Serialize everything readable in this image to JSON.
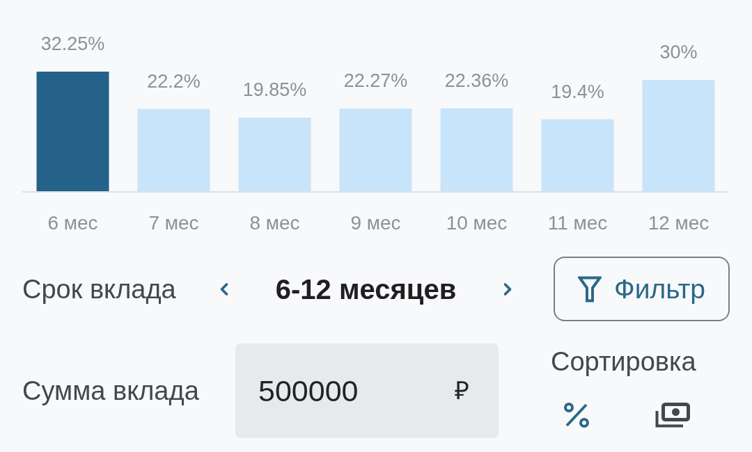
{
  "rate_chart": {
    "chart_data": {
      "type": "bar",
      "categories": [
        "6 мес",
        "7 мес",
        "8 мес",
        "9 мес",
        "10 мес",
        "11 мес",
        "12 мес"
      ],
      "series": [
        {
          "values": [
            32.25,
            22.2,
            19.85,
            22.27,
            22.36,
            19.4,
            30
          ],
          "value_labels": [
            "32.25%",
            "22.2%",
            "19.85%",
            "22.27%",
            "22.36%",
            "19.4%",
            "30%"
          ]
        }
      ]
    },
    "bar_states": [
      {
        "selected": true
      },
      {
        "selected": false
      },
      {
        "selected": false
      },
      {
        "selected": false
      },
      {
        "selected": false
      },
      {
        "selected": false
      },
      {
        "selected": false
      }
    ]
  },
  "term": {
    "label": "Срок вклада",
    "value": "6-12 месяцев"
  },
  "filter_button": {
    "label": "Фильтр"
  },
  "amount": {
    "label": "Сумма вклада",
    "value": "500000",
    "currency": "₽"
  },
  "sort": {
    "label": "Сортировка",
    "options": [
      {
        "kind": "percent",
        "selected": true
      },
      {
        "kind": "money",
        "selected": false
      }
    ]
  }
}
